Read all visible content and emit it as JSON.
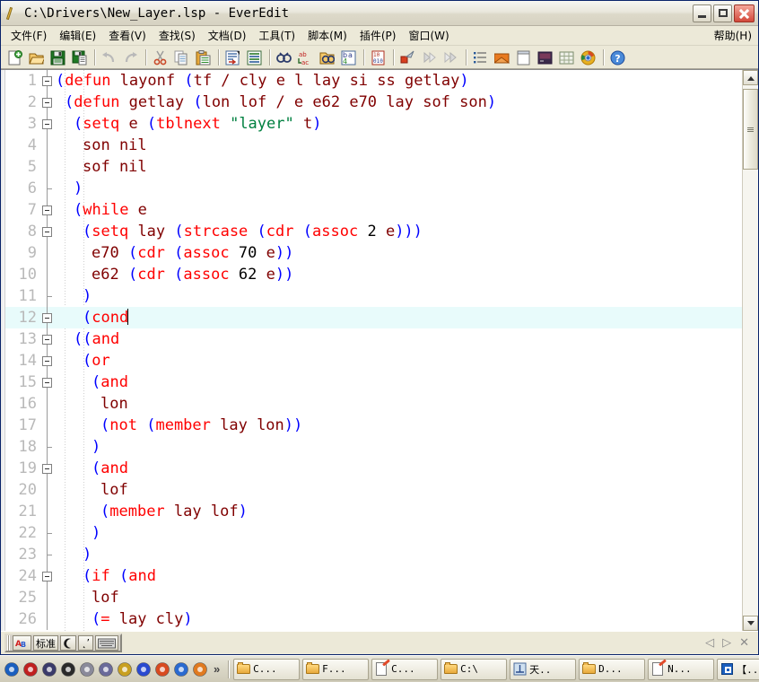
{
  "window": {
    "title": "C:\\Drivers\\New_Layer.lsp - EverEdit",
    "app_icon": "pen-edit-icon",
    "controls": {
      "minimize": "minimize-button",
      "maximize": "maximize-button",
      "close": "close-button"
    }
  },
  "menubar": {
    "items": [
      {
        "label": "文件(F)"
      },
      {
        "label": "编辑(E)"
      },
      {
        "label": "查看(V)"
      },
      {
        "label": "查找(S)"
      },
      {
        "label": "文档(D)"
      },
      {
        "label": "工具(T)"
      },
      {
        "label": "脚本(M)"
      },
      {
        "label": "插件(P)"
      },
      {
        "label": "窗口(W)"
      }
    ],
    "help": {
      "label": "帮助(H)"
    }
  },
  "toolbar": {
    "groups": [
      {
        "buttons": [
          {
            "name": "new-file-icon"
          },
          {
            "name": "open-file-icon"
          },
          {
            "name": "save-file-icon"
          },
          {
            "name": "save-all-icon"
          }
        ]
      },
      {
        "buttons": [
          {
            "name": "undo-icon"
          },
          {
            "name": "redo-icon"
          }
        ]
      },
      {
        "buttons": [
          {
            "name": "cut-icon"
          },
          {
            "name": "copy-icon"
          },
          {
            "name": "paste-icon"
          }
        ]
      },
      {
        "buttons": [
          {
            "name": "insert-line-icon"
          },
          {
            "name": "format-lines-icon"
          }
        ]
      },
      {
        "buttons": [
          {
            "name": "find-icon"
          },
          {
            "name": "replace-icon"
          },
          {
            "name": "find-in-files-icon"
          },
          {
            "name": "goto-icon"
          }
        ]
      },
      {
        "buttons": [
          {
            "name": "hex-view-icon"
          }
        ]
      },
      {
        "buttons": [
          {
            "name": "bookmark-toggle-icon"
          },
          {
            "name": "bookmark-next-icon"
          },
          {
            "name": "bookmark-prev-icon"
          }
        ]
      },
      {
        "buttons": [
          {
            "name": "outline-panel-icon"
          },
          {
            "name": "file-explorer-icon"
          },
          {
            "name": "clipboard-panel-icon"
          },
          {
            "name": "output-console-icon"
          },
          {
            "name": "char-map-icon"
          },
          {
            "name": "browser-preview-icon"
          }
        ]
      },
      {
        "buttons": [
          {
            "name": "help-icon"
          }
        ]
      }
    ]
  },
  "editor": {
    "current_line": 12,
    "caret_after": "(cond",
    "lines": [
      {
        "num": "1",
        "fold": "open",
        "indent": 0,
        "tokens": [
          {
            "t": "(",
            "c": "p"
          },
          {
            "t": "defun",
            "c": "k"
          },
          {
            "t": " layonf ",
            "c": "v"
          },
          {
            "t": "(",
            "c": "p"
          },
          {
            "t": "tf / cly e l lay si ss getlay",
            "c": "v"
          },
          {
            "t": ")",
            "c": "p"
          }
        ]
      },
      {
        "num": "2",
        "fold": "open",
        "indent": 1,
        "tokens": [
          {
            "t": "(",
            "c": "p"
          },
          {
            "t": "defun",
            "c": "k"
          },
          {
            "t": " getlay ",
            "c": "v"
          },
          {
            "t": "(",
            "c": "p"
          },
          {
            "t": "lon lof / e e62 e70 lay sof son",
            "c": "v"
          },
          {
            "t": ")",
            "c": "p"
          }
        ]
      },
      {
        "num": "3",
        "fold": "open",
        "indent": 2,
        "tokens": [
          {
            "t": "(",
            "c": "p"
          },
          {
            "t": "setq",
            "c": "k"
          },
          {
            "t": " e ",
            "c": "v"
          },
          {
            "t": "(",
            "c": "p"
          },
          {
            "t": "tblnext",
            "c": "k"
          },
          {
            "t": " ",
            "c": "v"
          },
          {
            "t": "\"layer\"",
            "c": "s"
          },
          {
            "t": " t",
            "c": "v"
          },
          {
            "t": ")",
            "c": "p"
          }
        ]
      },
      {
        "num": "4",
        "fold": "none",
        "indent": 3,
        "tokens": [
          {
            "t": "son nil",
            "c": "v"
          }
        ]
      },
      {
        "num": "5",
        "fold": "none",
        "indent": 3,
        "tokens": [
          {
            "t": "sof nil",
            "c": "v"
          }
        ]
      },
      {
        "num": "6",
        "fold": "end",
        "indent": 2,
        "tokens": [
          {
            "t": ")",
            "c": "p"
          }
        ]
      },
      {
        "num": "7",
        "fold": "open",
        "indent": 2,
        "tokens": [
          {
            "t": "(",
            "c": "p"
          },
          {
            "t": "while",
            "c": "k"
          },
          {
            "t": " e",
            "c": "v"
          }
        ]
      },
      {
        "num": "8",
        "fold": "open",
        "indent": 3,
        "tokens": [
          {
            "t": "(",
            "c": "p"
          },
          {
            "t": "setq",
            "c": "k"
          },
          {
            "t": " lay ",
            "c": "v"
          },
          {
            "t": "(",
            "c": "p"
          },
          {
            "t": "strcase",
            "c": "k"
          },
          {
            "t": " ",
            "c": "v"
          },
          {
            "t": "(",
            "c": "p"
          },
          {
            "t": "cdr",
            "c": "k"
          },
          {
            "t": " ",
            "c": "v"
          },
          {
            "t": "(",
            "c": "p"
          },
          {
            "t": "assoc",
            "c": "k"
          },
          {
            "t": " ",
            "c": "v"
          },
          {
            "t": "2",
            "c": "n"
          },
          {
            "t": " e",
            "c": "v"
          },
          {
            "t": ")))",
            "c": "p"
          }
        ]
      },
      {
        "num": "9",
        "fold": "none",
        "indent": 4,
        "tokens": [
          {
            "t": "e70 ",
            "c": "v"
          },
          {
            "t": "(",
            "c": "p"
          },
          {
            "t": "cdr",
            "c": "k"
          },
          {
            "t": " ",
            "c": "v"
          },
          {
            "t": "(",
            "c": "p"
          },
          {
            "t": "assoc",
            "c": "k"
          },
          {
            "t": " ",
            "c": "v"
          },
          {
            "t": "70",
            "c": "n"
          },
          {
            "t": " e",
            "c": "v"
          },
          {
            "t": "))",
            "c": "p"
          }
        ]
      },
      {
        "num": "10",
        "fold": "none",
        "indent": 4,
        "tokens": [
          {
            "t": "e62 ",
            "c": "v"
          },
          {
            "t": "(",
            "c": "p"
          },
          {
            "t": "cdr",
            "c": "k"
          },
          {
            "t": " ",
            "c": "v"
          },
          {
            "t": "(",
            "c": "p"
          },
          {
            "t": "assoc",
            "c": "k"
          },
          {
            "t": " ",
            "c": "v"
          },
          {
            "t": "62",
            "c": "n"
          },
          {
            "t": " e",
            "c": "v"
          },
          {
            "t": "))",
            "c": "p"
          }
        ]
      },
      {
        "num": "11",
        "fold": "end",
        "indent": 3,
        "tokens": [
          {
            "t": ")",
            "c": "p"
          }
        ]
      },
      {
        "num": "12",
        "fold": "open",
        "indent": 3,
        "tokens": [
          {
            "t": "(",
            "c": "p"
          },
          {
            "t": "cond",
            "c": "k"
          }
        ]
      },
      {
        "num": "13",
        "fold": "open",
        "indent": 2,
        "tokens": [
          {
            "t": "((",
            "c": "p"
          },
          {
            "t": "and",
            "c": "k"
          }
        ]
      },
      {
        "num": "14",
        "fold": "open",
        "indent": 3,
        "tokens": [
          {
            "t": "(",
            "c": "p"
          },
          {
            "t": "or",
            "c": "k"
          }
        ]
      },
      {
        "num": "15",
        "fold": "open",
        "indent": 4,
        "tokens": [
          {
            "t": "(",
            "c": "p"
          },
          {
            "t": "and",
            "c": "k"
          }
        ]
      },
      {
        "num": "16",
        "fold": "none",
        "indent": 5,
        "tokens": [
          {
            "t": "lon",
            "c": "v"
          }
        ]
      },
      {
        "num": "17",
        "fold": "none",
        "indent": 5,
        "tokens": [
          {
            "t": "(",
            "c": "p"
          },
          {
            "t": "not",
            "c": "k"
          },
          {
            "t": " ",
            "c": "v"
          },
          {
            "t": "(",
            "c": "p"
          },
          {
            "t": "member",
            "c": "k"
          },
          {
            "t": " lay lon",
            "c": "v"
          },
          {
            "t": "))",
            "c": "p"
          }
        ]
      },
      {
        "num": "18",
        "fold": "end",
        "indent": 4,
        "tokens": [
          {
            "t": ")",
            "c": "p"
          }
        ]
      },
      {
        "num": "19",
        "fold": "open",
        "indent": 4,
        "tokens": [
          {
            "t": "(",
            "c": "p"
          },
          {
            "t": "and",
            "c": "k"
          }
        ]
      },
      {
        "num": "20",
        "fold": "none",
        "indent": 5,
        "tokens": [
          {
            "t": "lof",
            "c": "v"
          }
        ]
      },
      {
        "num": "21",
        "fold": "none",
        "indent": 5,
        "tokens": [
          {
            "t": "(",
            "c": "p"
          },
          {
            "t": "member",
            "c": "k"
          },
          {
            "t": " lay lof",
            "c": "v"
          },
          {
            "t": ")",
            "c": "p"
          }
        ]
      },
      {
        "num": "22",
        "fold": "end",
        "indent": 4,
        "tokens": [
          {
            "t": ")",
            "c": "p"
          }
        ]
      },
      {
        "num": "23",
        "fold": "end",
        "indent": 3,
        "tokens": [
          {
            "t": ")",
            "c": "p"
          }
        ]
      },
      {
        "num": "24",
        "fold": "open",
        "indent": 3,
        "tokens": [
          {
            "t": "(",
            "c": "p"
          },
          {
            "t": "if",
            "c": "k"
          },
          {
            "t": " ",
            "c": "v"
          },
          {
            "t": "(",
            "c": "p"
          },
          {
            "t": "and",
            "c": "k"
          }
        ]
      },
      {
        "num": "25",
        "fold": "none",
        "indent": 4,
        "tokens": [
          {
            "t": "lof",
            "c": "v"
          }
        ]
      },
      {
        "num": "26",
        "fold": "none",
        "indent": 4,
        "tokens": [
          {
            "t": "(",
            "c": "p"
          },
          {
            "t": "=",
            "c": "k"
          },
          {
            "t": " lay cly",
            "c": "v"
          },
          {
            "t": ")",
            "c": "p"
          }
        ]
      }
    ]
  },
  "scrollbar": {
    "up_arrow": "scroll-up-arrow",
    "down_arrow": "scroll-down-arrow",
    "thumb": "scroll-thumb"
  },
  "statusbar": {
    "ime": {
      "logo": "ime-logo-icon",
      "mode_label": "标准",
      "shape_icon": "moon-icon",
      "punct_label": "˛ʼ",
      "keyboard_icon": "keyboard-icon"
    },
    "nav": {
      "prev": "◁",
      "next": "▷",
      "close": "✕"
    }
  },
  "taskbar": {
    "quicklaunch": [
      {
        "name": "maxthon-browser-icon"
      },
      {
        "name": "font-viewer-icon"
      },
      {
        "name": "show-desktop-icon"
      },
      {
        "name": "recorder-icon"
      },
      {
        "name": "disc-burn-icon"
      },
      {
        "name": "cd-player-icon"
      },
      {
        "name": "webcam-icon"
      },
      {
        "name": "media-player-icon"
      },
      {
        "name": "qq-messenger-icon"
      },
      {
        "name": "thunder-download-icon"
      },
      {
        "name": "audio-tool-icon"
      }
    ],
    "more_label": "»",
    "tasks": [
      {
        "icon": "folder-icon",
        "label": "C..."
      },
      {
        "icon": "folder-icon",
        "label": "F..."
      },
      {
        "icon": "notepad-icon",
        "label": "C..."
      },
      {
        "icon": "folder-icon",
        "label": "C:\\"
      },
      {
        "icon": "app-icon",
        "label": "天.."
      },
      {
        "icon": "folder-icon",
        "label": "D..."
      },
      {
        "icon": "notepad-icon",
        "label": "N..."
      },
      {
        "icon": "blueapp-icon",
        "label": "【.."
      }
    ]
  },
  "colors": {
    "keyword": "#ff0000",
    "paren": "#0000ff",
    "symbol": "#800000",
    "string": "#008040",
    "number": "#000000",
    "current_line_bg": "#e8fbfb",
    "line_number": "#b9b9b9",
    "window_chrome": "#ece9d8",
    "title_bar": "#e9e7dc"
  }
}
